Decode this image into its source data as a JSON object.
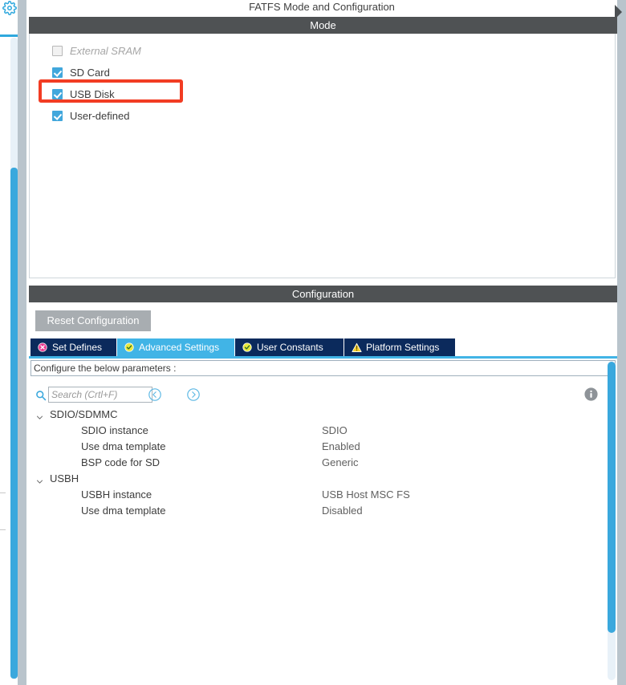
{
  "window": {
    "title": "FATFS Mode and Configuration",
    "collapse_icon": "collapse-triangle-icon",
    "gear_icon": "gear-icon"
  },
  "mode": {
    "header": "Mode",
    "options": [
      {
        "label": "External SRAM",
        "checked": false,
        "enabled": false
      },
      {
        "label": "SD Card",
        "checked": true,
        "enabled": true
      },
      {
        "label": "USB Disk",
        "checked": true,
        "enabled": true
      },
      {
        "label": "User-defined",
        "checked": true,
        "enabled": true
      }
    ],
    "highlight": {
      "target": "USB Disk",
      "color": "#f23c23"
    }
  },
  "configuration": {
    "header": "Configuration",
    "reset_button": "Reset Configuration",
    "tabs": [
      {
        "label": "Set Defines",
        "icon": "error-circle-icon",
        "active": false
      },
      {
        "label": "Advanced Settings",
        "icon": "check-circle-icon",
        "active": true
      },
      {
        "label": "User Constants",
        "icon": "check-circle-icon",
        "active": false
      },
      {
        "label": "Platform Settings",
        "icon": "warning-triangle-icon",
        "active": false
      }
    ],
    "instruction": "Configure the below parameters :",
    "search": {
      "placeholder": "Search (Crtl+F)",
      "value": "",
      "icon": "search-icon",
      "prev_icon": "chevron-left-circle-icon",
      "next_icon": "chevron-right-circle-icon"
    },
    "info_icon": "info-circle-icon",
    "groups": [
      {
        "label": "SDIO/SDMMC",
        "expanded": true,
        "rows": [
          {
            "name": "SDIO instance",
            "value": "SDIO"
          },
          {
            "name": "Use dma template",
            "value": "Enabled"
          },
          {
            "name": "BSP code for SD",
            "value": "Generic"
          }
        ]
      },
      {
        "label": "USBH",
        "expanded": true,
        "rows": [
          {
            "name": "USBH instance",
            "value": "USB Host MSC FS"
          },
          {
            "name": "Use dma template",
            "value": "Disabled"
          }
        ]
      }
    ]
  },
  "colors": {
    "header_bar": "#4f5254",
    "tab_inactive": "#0b2a5c",
    "tab_active": "#41b4e6",
    "checkbox": "#41a7dc",
    "accent": "#3aa8dd",
    "highlight": "#f23c23"
  }
}
